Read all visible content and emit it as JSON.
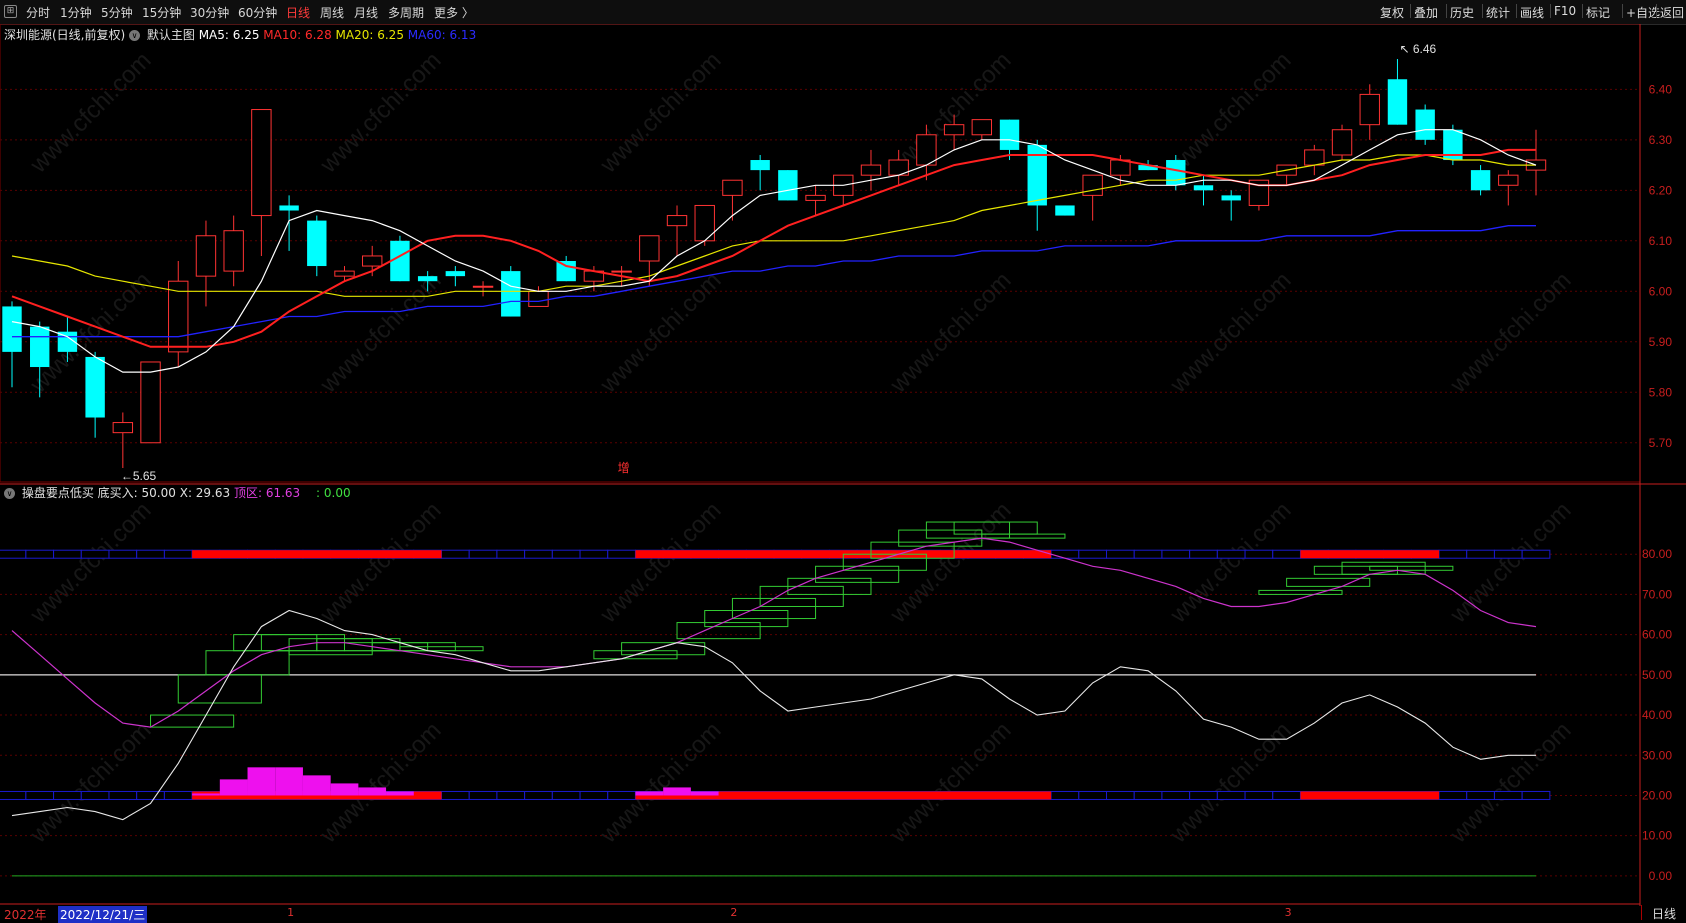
{
  "toolbar": {
    "periods": [
      "分时",
      "1分钟",
      "5分钟",
      "15分钟",
      "30分钟",
      "60分钟",
      "日线",
      "周线",
      "月线",
      "多周期",
      "更多 〉"
    ],
    "active_period": "日线",
    "right_buttons": [
      "复权",
      "叠加",
      "历史",
      "统计",
      "画线",
      "F10",
      "标记",
      "+自选",
      "返回"
    ]
  },
  "main_legend": {
    "stock": "深圳能源(日线,前复权)",
    "template": "默认主图",
    "ma5": "MA5: 6.25",
    "ma10": "MA10: 6.28",
    "ma20": "MA20: 6.25",
    "ma60": "MA60: 6.13"
  },
  "sub_legend": {
    "name": "操盘要点低买",
    "buy": "底买入: 50.00",
    "x": "X: 29.63",
    "top": "顶区: 61.63",
    "extra": ": 0.00"
  },
  "annotations": {
    "high": "6.46",
    "low": "5.65",
    "marker": "增"
  },
  "price_axis": [
    "6.40",
    "6.30",
    "6.20",
    "6.10",
    "6.00",
    "5.90",
    "5.80",
    "5.70"
  ],
  "ind_axis": [
    "80.00",
    "70.00",
    "60.00",
    "50.00",
    "40.00",
    "30.00",
    "20.00",
    "10.00",
    "0.00"
  ],
  "bottom": {
    "year": "2022年",
    "date": "2022/12/21/三",
    "months": [
      "1",
      "2",
      "3"
    ],
    "period": "日线"
  },
  "watermark": "www.cfchi.com",
  "colors": {
    "up": "#ff3333",
    "down": "#00ffff",
    "ma5": "#ffffff",
    "ma10": "#ff2020",
    "ma20": "#e6e600",
    "ma60": "#2222ff",
    "axis": "#c81e1e",
    "bandred": "#ff0000",
    "bandblue": "#1a1acc",
    "magenta": "#cc33cc",
    "green": "#44cc44"
  },
  "chart_data": {
    "type": "candlestick",
    "ohlc": [
      [
        5.97,
        5.98,
        5.81,
        5.88
      ],
      [
        5.93,
        5.94,
        5.79,
        5.85
      ],
      [
        5.92,
        5.95,
        5.86,
        5.88
      ],
      [
        5.87,
        5.88,
        5.71,
        5.75
      ],
      [
        5.72,
        5.76,
        5.65,
        5.74
      ],
      [
        5.7,
        5.86,
        5.7,
        5.86
      ],
      [
        5.88,
        6.06,
        5.85,
        6.02
      ],
      [
        6.03,
        6.14,
        5.97,
        6.11
      ],
      [
        6.04,
        6.15,
        6.01,
        6.12
      ],
      [
        6.15,
        6.36,
        6.07,
        6.36
      ],
      [
        6.17,
        6.19,
        6.08,
        6.16
      ],
      [
        6.14,
        6.15,
        6.03,
        6.05
      ],
      [
        6.03,
        6.05,
        6.02,
        6.04
      ],
      [
        6.05,
        6.09,
        6.03,
        6.07
      ],
      [
        6.1,
        6.11,
        6.02,
        6.02
      ],
      [
        6.03,
        6.04,
        6.0,
        6.02
      ],
      [
        6.04,
        6.05,
        6.01,
        6.03
      ],
      [
        6.01,
        6.02,
        5.99,
        6.01
      ],
      [
        6.04,
        6.05,
        5.95,
        5.95
      ],
      [
        5.97,
        6.01,
        5.97,
        6.0
      ],
      [
        6.06,
        6.07,
        6.02,
        6.02
      ],
      [
        6.02,
        6.05,
        6.0,
        6.04
      ],
      [
        6.04,
        6.05,
        6.01,
        6.04
      ],
      [
        6.06,
        6.11,
        6.01,
        6.11
      ],
      [
        6.13,
        6.17,
        6.07,
        6.15
      ],
      [
        6.1,
        6.16,
        6.09,
        6.17
      ],
      [
        6.19,
        6.22,
        6.14,
        6.22
      ],
      [
        6.26,
        6.27,
        6.2,
        6.24
      ],
      [
        6.24,
        6.24,
        6.18,
        6.18
      ],
      [
        6.18,
        6.21,
        6.15,
        6.19
      ],
      [
        6.19,
        6.23,
        6.17,
        6.23
      ],
      [
        6.23,
        6.28,
        6.2,
        6.25
      ],
      [
        6.23,
        6.28,
        6.21,
        6.26
      ],
      [
        6.25,
        6.33,
        6.22,
        6.31
      ],
      [
        6.31,
        6.35,
        6.28,
        6.33
      ],
      [
        6.31,
        6.34,
        6.3,
        6.34
      ],
      [
        6.34,
        6.34,
        6.26,
        6.28
      ],
      [
        6.29,
        6.3,
        6.12,
        6.17
      ],
      [
        6.17,
        6.17,
        6.15,
        6.15
      ],
      [
        6.19,
        6.23,
        6.14,
        6.23
      ],
      [
        6.23,
        6.27,
        6.21,
        6.26
      ],
      [
        6.25,
        6.26,
        6.24,
        6.24
      ],
      [
        6.26,
        6.27,
        6.2,
        6.21
      ],
      [
        6.21,
        6.23,
        6.17,
        6.2
      ],
      [
        6.19,
        6.2,
        6.14,
        6.18
      ],
      [
        6.17,
        6.22,
        6.16,
        6.22
      ],
      [
        6.23,
        6.25,
        6.21,
        6.25
      ],
      [
        6.25,
        6.29,
        6.23,
        6.28
      ],
      [
        6.27,
        6.33,
        6.26,
        6.32
      ],
      [
        6.33,
        6.41,
        6.3,
        6.39
      ],
      [
        6.42,
        6.46,
        6.33,
        6.33
      ],
      [
        6.36,
        6.37,
        6.29,
        6.3
      ],
      [
        6.32,
        6.33,
        6.25,
        6.26
      ],
      [
        6.24,
        6.25,
        6.19,
        6.2
      ],
      [
        6.21,
        6.24,
        6.17,
        6.23
      ],
      [
        6.24,
        6.32,
        6.19,
        6.26
      ]
    ],
    "ma5": [
      5.94,
      5.93,
      5.91,
      5.87,
      5.84,
      5.84,
      5.85,
      5.88,
      5.93,
      6.02,
      6.14,
      6.16,
      6.15,
      6.14,
      6.12,
      6.09,
      6.06,
      6.04,
      6.01,
      6.0,
      6.0,
      6.01,
      6.01,
      6.02,
      6.07,
      6.1,
      6.15,
      6.19,
      6.2,
      6.21,
      6.21,
      6.22,
      6.23,
      6.25,
      6.28,
      6.3,
      6.3,
      6.29,
      6.26,
      6.24,
      6.22,
      6.21,
      6.21,
      6.22,
      6.22,
      6.21,
      6.21,
      6.22,
      6.25,
      6.28,
      6.31,
      6.32,
      6.32,
      6.3,
      6.27,
      6.25
    ],
    "ma10": [
      5.99,
      5.97,
      5.95,
      5.93,
      5.91,
      5.89,
      5.89,
      5.89,
      5.9,
      5.92,
      5.96,
      5.99,
      6.02,
      6.04,
      6.07,
      6.1,
      6.11,
      6.11,
      6.1,
      6.08,
      6.05,
      6.04,
      6.03,
      6.02,
      6.03,
      6.05,
      6.07,
      6.1,
      6.13,
      6.15,
      6.17,
      6.19,
      6.21,
      6.23,
      6.25,
      6.26,
      6.27,
      6.27,
      6.27,
      6.27,
      6.26,
      6.25,
      6.24,
      6.23,
      6.22,
      6.21,
      6.21,
      6.22,
      6.23,
      6.25,
      6.26,
      6.27,
      6.27,
      6.27,
      6.28,
      6.28
    ],
    "ma20": [
      6.07,
      6.06,
      6.05,
      6.03,
      6.02,
      6.01,
      6.0,
      6.0,
      6.0,
      6.0,
      6.0,
      6.0,
      5.99,
      5.99,
      5.99,
      5.99,
      6.0,
      6.0,
      6.0,
      6.0,
      6.01,
      6.01,
      6.02,
      6.03,
      6.05,
      6.07,
      6.09,
      6.1,
      6.1,
      6.1,
      6.1,
      6.11,
      6.12,
      6.13,
      6.14,
      6.16,
      6.17,
      6.18,
      6.19,
      6.2,
      6.21,
      6.22,
      6.22,
      6.23,
      6.23,
      6.23,
      6.24,
      6.25,
      6.26,
      6.26,
      6.27,
      6.27,
      6.26,
      6.26,
      6.25,
      6.25
    ],
    "ma60": [
      5.91,
      5.91,
      5.91,
      5.91,
      5.91,
      5.91,
      5.91,
      5.92,
      5.93,
      5.94,
      5.95,
      5.95,
      5.96,
      5.96,
      5.96,
      5.97,
      5.97,
      5.97,
      5.98,
      5.98,
      5.99,
      5.99,
      6.0,
      6.01,
      6.02,
      6.03,
      6.04,
      6.04,
      6.05,
      6.05,
      6.06,
      6.06,
      6.07,
      6.07,
      6.07,
      6.08,
      6.08,
      6.08,
      6.09,
      6.09,
      6.09,
      6.09,
      6.1,
      6.1,
      6.1,
      6.1,
      6.11,
      6.11,
      6.11,
      6.11,
      6.12,
      6.12,
      6.12,
      6.12,
      6.13,
      6.13
    ],
    "price_range": [
      5.65,
      6.47
    ],
    "indicator": {
      "ylim": [
        -5,
        90
      ],
      "white_line": [
        15,
        16,
        17,
        16,
        14,
        18,
        28,
        40,
        52,
        62,
        66,
        64,
        61,
        60,
        58,
        56,
        55,
        53,
        51,
        51,
        52,
        53,
        54,
        56,
        58,
        57,
        53,
        46,
        41,
        42,
        43,
        44,
        46,
        48,
        50,
        49,
        44,
        40,
        41,
        48,
        52,
        51,
        46,
        39,
        37,
        34,
        34,
        38,
        43,
        45,
        42,
        38,
        32,
        29,
        30,
        30
      ],
      "magenta_line": [
        61,
        55,
        49,
        43,
        38,
        37,
        41,
        46,
        51,
        55,
        57,
        58,
        58,
        57,
        56,
        55,
        54,
        53,
        52,
        52,
        52,
        53,
        54,
        56,
        58,
        61,
        64,
        67,
        71,
        74,
        76,
        78,
        80,
        82,
        83,
        84,
        83,
        81,
        79,
        77,
        76,
        74,
        72,
        69,
        67,
        67,
        68,
        70,
        72,
        75,
        76,
        75,
        71,
        66,
        63,
        62
      ],
      "midline": 50,
      "red_band_ranges": [
        [
          7,
          15
        ],
        [
          23,
          37
        ],
        [
          47,
          51
        ]
      ],
      "magenta_bars": [
        [
          7,
          20.5
        ],
        [
          8,
          24
        ],
        [
          9,
          27
        ],
        [
          10,
          27
        ],
        [
          11,
          25
        ],
        [
          12,
          23
        ],
        [
          13,
          22
        ],
        [
          14,
          21
        ],
        [
          23,
          21
        ],
        [
          24,
          22
        ],
        [
          25,
          21
        ]
      ],
      "green_boxes": [
        [
          5,
          8,
          37,
          40
        ],
        [
          6,
          9,
          43,
          50
        ],
        [
          7,
          10,
          50,
          56
        ],
        [
          8,
          11,
          56,
          60
        ],
        [
          9,
          12,
          56,
          60
        ],
        [
          10,
          13,
          55,
          59
        ],
        [
          11,
          14,
          56,
          59
        ],
        [
          12,
          15,
          56,
          58
        ],
        [
          13,
          16,
          56,
          58
        ],
        [
          14,
          17,
          56,
          57
        ],
        [
          21,
          24,
          54,
          56
        ],
        [
          22,
          25,
          55,
          58
        ],
        [
          24,
          27,
          59,
          63
        ],
        [
          25,
          28,
          62,
          66
        ],
        [
          26,
          29,
          64,
          69
        ],
        [
          27,
          30,
          67,
          72
        ],
        [
          28,
          31,
          70,
          74
        ],
        [
          29,
          32,
          73,
          77
        ],
        [
          30,
          33,
          76,
          80
        ],
        [
          31,
          34,
          79,
          83
        ],
        [
          32,
          35,
          82,
          86
        ],
        [
          33,
          36,
          84,
          88
        ],
        [
          34,
          37,
          85,
          88
        ],
        [
          35,
          38,
          84,
          85
        ],
        [
          45,
          48,
          70,
          71
        ],
        [
          46,
          49,
          72,
          74
        ],
        [
          47,
          50,
          75,
          77
        ],
        [
          48,
          51,
          75,
          78
        ],
        [
          49,
          52,
          76,
          77
        ]
      ]
    }
  }
}
